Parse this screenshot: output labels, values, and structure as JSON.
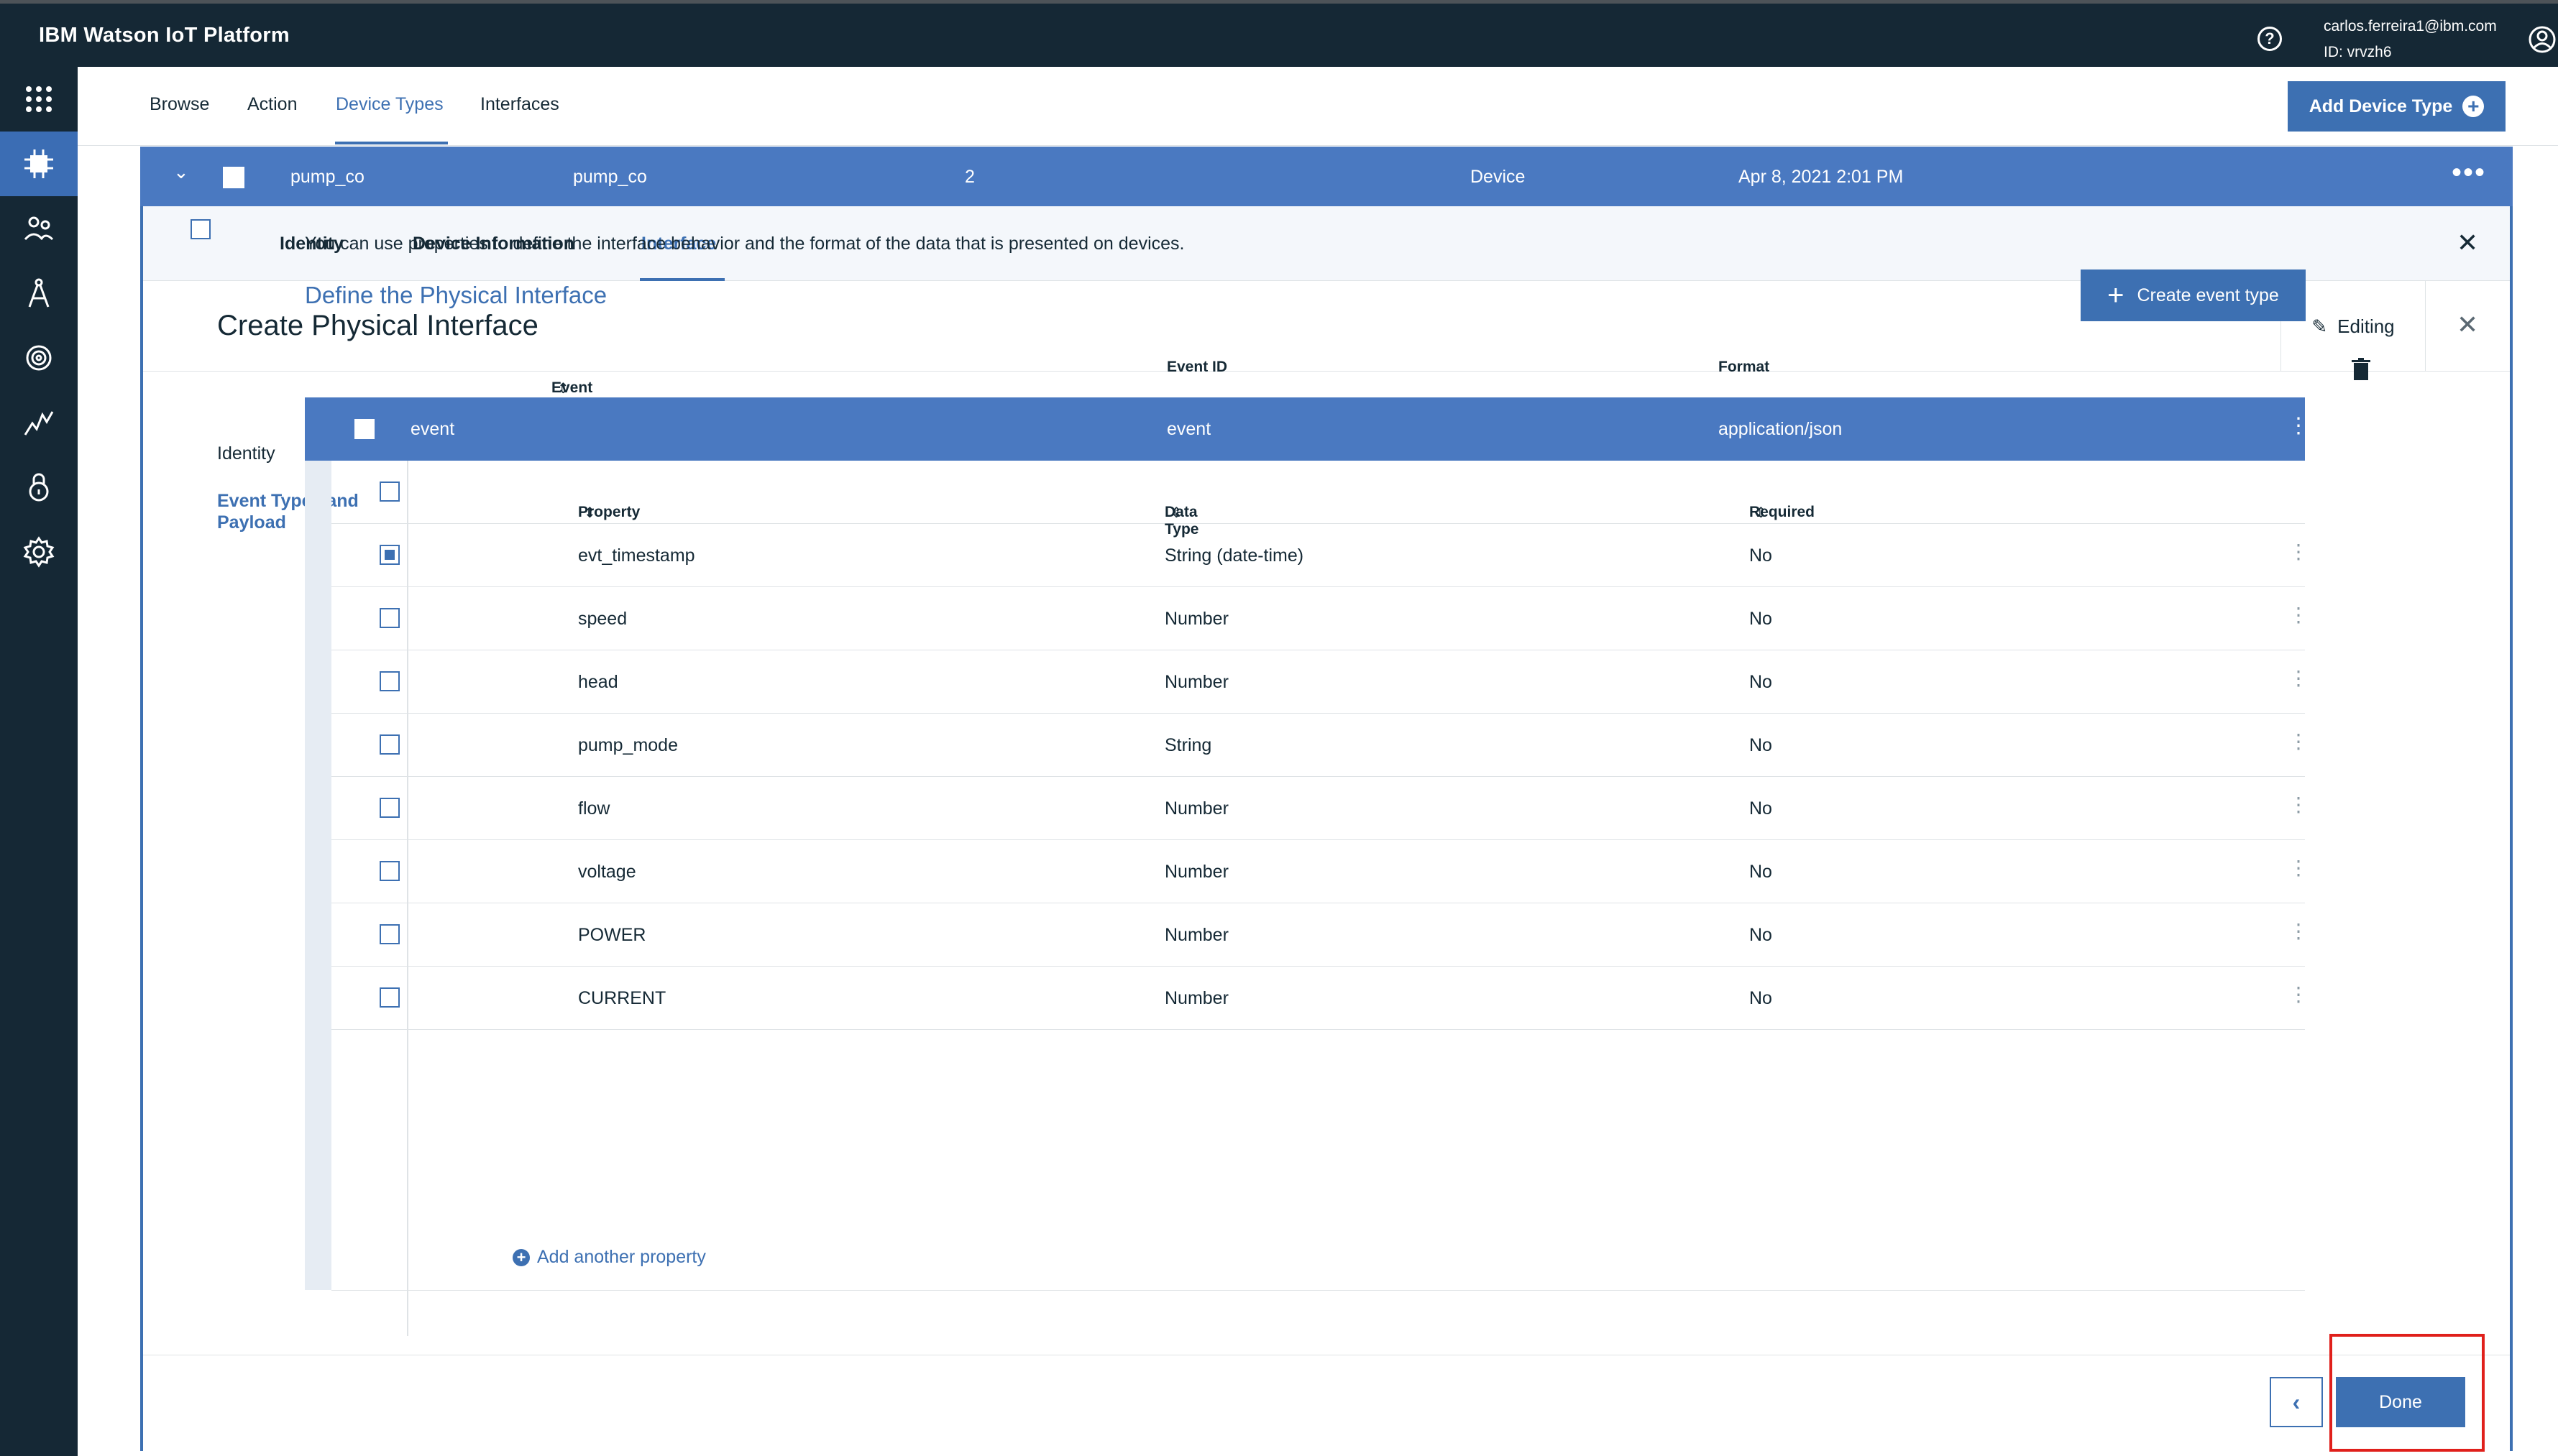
{
  "app": {
    "title": "IBM Watson IoT Platform",
    "user_email": "carlos.ferreira1@ibm.com",
    "user_id": "ID: vrvzh6"
  },
  "sidenav": {
    "icons": [
      "apps-icon",
      "devices-icon",
      "members-icon",
      "apps-compass-icon",
      "analytics-icon",
      "usage-icon",
      "security-icon",
      "settings-icon"
    ]
  },
  "subnav": {
    "tabs": [
      "Browse",
      "Action",
      "Device Types",
      "Interfaces"
    ],
    "active": "Device Types",
    "add_button": "Add Device Type"
  },
  "device_row": {
    "col1": "pump_co",
    "col2": "pump_co",
    "col3": "2",
    "col4": "Device",
    "col5": "Apr 8, 2021 2:01 PM"
  },
  "detail_tabs": {
    "tabs": [
      "Identity",
      "Device Information",
      "Interface"
    ],
    "active": "Interface"
  },
  "panel": {
    "title": "Create Physical Interface",
    "editing": "Editing",
    "side_identity": "Identity",
    "side_event": "Event Types and Payload",
    "intro": "You can use properties to define the interface behavior and the format of the data that is presented on devices.",
    "define": "Define the Physical Interface",
    "create_event": "Create event type"
  },
  "event_table": {
    "headers": [
      "Event Type",
      "Event ID",
      "Format"
    ],
    "row": {
      "type": "event",
      "id": "event",
      "format": "application/json"
    }
  },
  "property_table": {
    "headers": [
      "Property",
      "Data Type",
      "Required"
    ],
    "rows": [
      {
        "property": "evt_timestamp",
        "type": "String (date-time)",
        "required": "No",
        "checked": true
      },
      {
        "property": "speed",
        "type": "Number",
        "required": "No",
        "checked": false
      },
      {
        "property": "head",
        "type": "Number",
        "required": "No",
        "checked": false
      },
      {
        "property": "pump_mode",
        "type": "String",
        "required": "No",
        "checked": false
      },
      {
        "property": "flow",
        "type": "Number",
        "required": "No",
        "checked": false
      },
      {
        "property": "voltage",
        "type": "Number",
        "required": "No",
        "checked": false
      },
      {
        "property": "POWER",
        "type": "Number",
        "required": "No",
        "checked": false
      },
      {
        "property": "CURRENT",
        "type": "Number",
        "required": "No",
        "checked": false
      }
    ],
    "add_label": "Add another property"
  },
  "footer": {
    "done": "Done"
  }
}
